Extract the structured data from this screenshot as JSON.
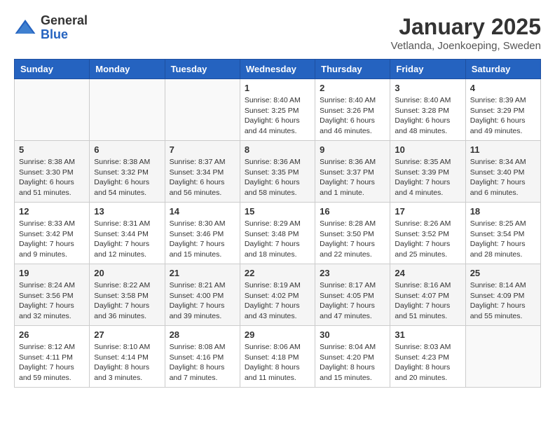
{
  "header": {
    "logo_general": "General",
    "logo_blue": "Blue",
    "month": "January 2025",
    "location": "Vetlanda, Joenkoeping, Sweden"
  },
  "weekdays": [
    "Sunday",
    "Monday",
    "Tuesday",
    "Wednesday",
    "Thursday",
    "Friday",
    "Saturday"
  ],
  "weeks": [
    [
      {
        "day": "",
        "info": ""
      },
      {
        "day": "",
        "info": ""
      },
      {
        "day": "",
        "info": ""
      },
      {
        "day": "1",
        "info": "Sunrise: 8:40 AM\nSunset: 3:25 PM\nDaylight: 6 hours\nand 44 minutes."
      },
      {
        "day": "2",
        "info": "Sunrise: 8:40 AM\nSunset: 3:26 PM\nDaylight: 6 hours\nand 46 minutes."
      },
      {
        "day": "3",
        "info": "Sunrise: 8:40 AM\nSunset: 3:28 PM\nDaylight: 6 hours\nand 48 minutes."
      },
      {
        "day": "4",
        "info": "Sunrise: 8:39 AM\nSunset: 3:29 PM\nDaylight: 6 hours\nand 49 minutes."
      }
    ],
    [
      {
        "day": "5",
        "info": "Sunrise: 8:38 AM\nSunset: 3:30 PM\nDaylight: 6 hours\nand 51 minutes."
      },
      {
        "day": "6",
        "info": "Sunrise: 8:38 AM\nSunset: 3:32 PM\nDaylight: 6 hours\nand 54 minutes."
      },
      {
        "day": "7",
        "info": "Sunrise: 8:37 AM\nSunset: 3:34 PM\nDaylight: 6 hours\nand 56 minutes."
      },
      {
        "day": "8",
        "info": "Sunrise: 8:36 AM\nSunset: 3:35 PM\nDaylight: 6 hours\nand 58 minutes."
      },
      {
        "day": "9",
        "info": "Sunrise: 8:36 AM\nSunset: 3:37 PM\nDaylight: 7 hours\nand 1 minute."
      },
      {
        "day": "10",
        "info": "Sunrise: 8:35 AM\nSunset: 3:39 PM\nDaylight: 7 hours\nand 4 minutes."
      },
      {
        "day": "11",
        "info": "Sunrise: 8:34 AM\nSunset: 3:40 PM\nDaylight: 7 hours\nand 6 minutes."
      }
    ],
    [
      {
        "day": "12",
        "info": "Sunrise: 8:33 AM\nSunset: 3:42 PM\nDaylight: 7 hours\nand 9 minutes."
      },
      {
        "day": "13",
        "info": "Sunrise: 8:31 AM\nSunset: 3:44 PM\nDaylight: 7 hours\nand 12 minutes."
      },
      {
        "day": "14",
        "info": "Sunrise: 8:30 AM\nSunset: 3:46 PM\nDaylight: 7 hours\nand 15 minutes."
      },
      {
        "day": "15",
        "info": "Sunrise: 8:29 AM\nSunset: 3:48 PM\nDaylight: 7 hours\nand 18 minutes."
      },
      {
        "day": "16",
        "info": "Sunrise: 8:28 AM\nSunset: 3:50 PM\nDaylight: 7 hours\nand 22 minutes."
      },
      {
        "day": "17",
        "info": "Sunrise: 8:26 AM\nSunset: 3:52 PM\nDaylight: 7 hours\nand 25 minutes."
      },
      {
        "day": "18",
        "info": "Sunrise: 8:25 AM\nSunset: 3:54 PM\nDaylight: 7 hours\nand 28 minutes."
      }
    ],
    [
      {
        "day": "19",
        "info": "Sunrise: 8:24 AM\nSunset: 3:56 PM\nDaylight: 7 hours\nand 32 minutes."
      },
      {
        "day": "20",
        "info": "Sunrise: 8:22 AM\nSunset: 3:58 PM\nDaylight: 7 hours\nand 36 minutes."
      },
      {
        "day": "21",
        "info": "Sunrise: 8:21 AM\nSunset: 4:00 PM\nDaylight: 7 hours\nand 39 minutes."
      },
      {
        "day": "22",
        "info": "Sunrise: 8:19 AM\nSunset: 4:02 PM\nDaylight: 7 hours\nand 43 minutes."
      },
      {
        "day": "23",
        "info": "Sunrise: 8:17 AM\nSunset: 4:05 PM\nDaylight: 7 hours\nand 47 minutes."
      },
      {
        "day": "24",
        "info": "Sunrise: 8:16 AM\nSunset: 4:07 PM\nDaylight: 7 hours\nand 51 minutes."
      },
      {
        "day": "25",
        "info": "Sunrise: 8:14 AM\nSunset: 4:09 PM\nDaylight: 7 hours\nand 55 minutes."
      }
    ],
    [
      {
        "day": "26",
        "info": "Sunrise: 8:12 AM\nSunset: 4:11 PM\nDaylight: 7 hours\nand 59 minutes."
      },
      {
        "day": "27",
        "info": "Sunrise: 8:10 AM\nSunset: 4:14 PM\nDaylight: 8 hours\nand 3 minutes."
      },
      {
        "day": "28",
        "info": "Sunrise: 8:08 AM\nSunset: 4:16 PM\nDaylight: 8 hours\nand 7 minutes."
      },
      {
        "day": "29",
        "info": "Sunrise: 8:06 AM\nSunset: 4:18 PM\nDaylight: 8 hours\nand 11 minutes."
      },
      {
        "day": "30",
        "info": "Sunrise: 8:04 AM\nSunset: 4:20 PM\nDaylight: 8 hours\nand 15 minutes."
      },
      {
        "day": "31",
        "info": "Sunrise: 8:03 AM\nSunset: 4:23 PM\nDaylight: 8 hours\nand 20 minutes."
      },
      {
        "day": "",
        "info": ""
      }
    ]
  ]
}
